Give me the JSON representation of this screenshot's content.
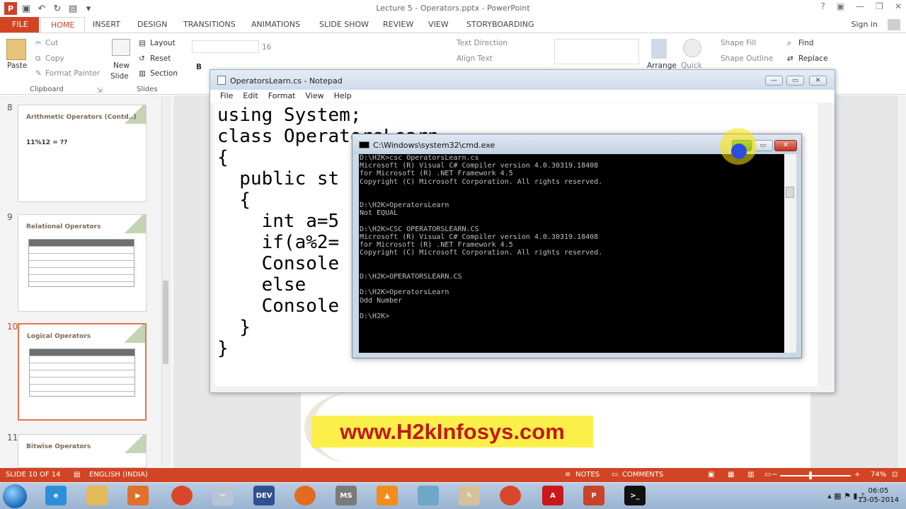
{
  "window": {
    "title": "Lecture 5 - Operators.pptx - PowerPoint",
    "help": "?",
    "sign_in": "Sign in"
  },
  "ribbon_tabs": [
    "FILE",
    "HOME",
    "INSERT",
    "DESIGN",
    "TRANSITIONS",
    "ANIMATIONS",
    "SLIDE SHOW",
    "REVIEW",
    "VIEW",
    "STORYBOARDING"
  ],
  "ribbon": {
    "clipboard": {
      "paste": "Paste",
      "cut": "Cut",
      "copy": "Copy",
      "format_painter": "Format Painter",
      "label": "Clipboard"
    },
    "slides": {
      "new_slide_1": "New",
      "new_slide_2": "Slide",
      "layout": "Layout",
      "reset": "Reset",
      "section": "Section",
      "label": "Slides"
    },
    "font": {
      "size": "16",
      "bold": "B"
    },
    "paragraph": {
      "text_direction": "Text Direction",
      "align_text": "Align Text"
    },
    "drawing": {
      "arrange": "Arrange",
      "quick": "Quick",
      "shape_fill": "Shape Fill",
      "shape_outline": "Shape Outline"
    },
    "editing": {
      "find": "Find",
      "replace": "Replace"
    }
  },
  "slides_pane": {
    "items": [
      {
        "number": "8",
        "title": "Arithmetic Operators (Contd..)",
        "body": "11%12 = ??"
      },
      {
        "number": "9",
        "title": "Relational Operators"
      },
      {
        "number": "10",
        "title": "Logical Operators"
      },
      {
        "number": "11",
        "title": "Bitwise Operators"
      }
    ]
  },
  "notepad": {
    "title": "OperatorsLearn.cs - Notepad",
    "menu": [
      "File",
      "Edit",
      "Format",
      "View",
      "Help"
    ],
    "code": "using System;\nclass OperatorsLearn\n{\n  public st\n  {\n    int a=5\n    if(a%2=\n    Console\n    else\n    Console\n  }\n}"
  },
  "cmd": {
    "title": "C:\\Windows\\system32\\cmd.exe",
    "output": "D:\\H2K>csc OperatorsLearn.cs\nMicrosoft (R) Visual C# Compiler version 4.0.30319.18408\nfor Microsoft (R) .NET Framework 4.5\nCopyright (C) Microsoft Corporation. All rights reserved.\n\n\nD:\\H2K>OperatorsLearn\nNot EQUAL\n\nD:\\H2K>CSC OPERATORSLEARN.CS\nMicrosoft (R) Visual C# Compiler version 4.0.30319.18408\nfor Microsoft (R) .NET Framework 4.5\nCopyright (C) Microsoft Corporation. All rights reserved.\n\n\nD:\\H2K>OPERATORSLEARN.CS\n\nD:\\H2K>OperatorsLearn\nOdd Number\n\nD:\\H2K>"
  },
  "watermark": "www.H2kInfosys.com",
  "status": {
    "slide": "SLIDE 10 OF 14",
    "language": "ENGLISH (INDIA)",
    "notes": "NOTES",
    "comments": "COMMENTS",
    "zoom": "74%",
    "zoom_minus": "−",
    "zoom_plus": "+"
  },
  "taskbar": {
    "icons": [
      "ie",
      "explorer",
      "media",
      "chrome",
      "snipping",
      "devc",
      "firefox",
      "msoffice",
      "vlc",
      "virtualbox",
      "paint",
      "chrome-2",
      "acrobat",
      "powerpoint",
      "cmd"
    ],
    "time": "06:05",
    "date": "13-05-2014"
  },
  "colors": {
    "accent": "#d14424",
    "watermark_bg": "#fbf04a",
    "watermark_text": "#c21a1a"
  }
}
